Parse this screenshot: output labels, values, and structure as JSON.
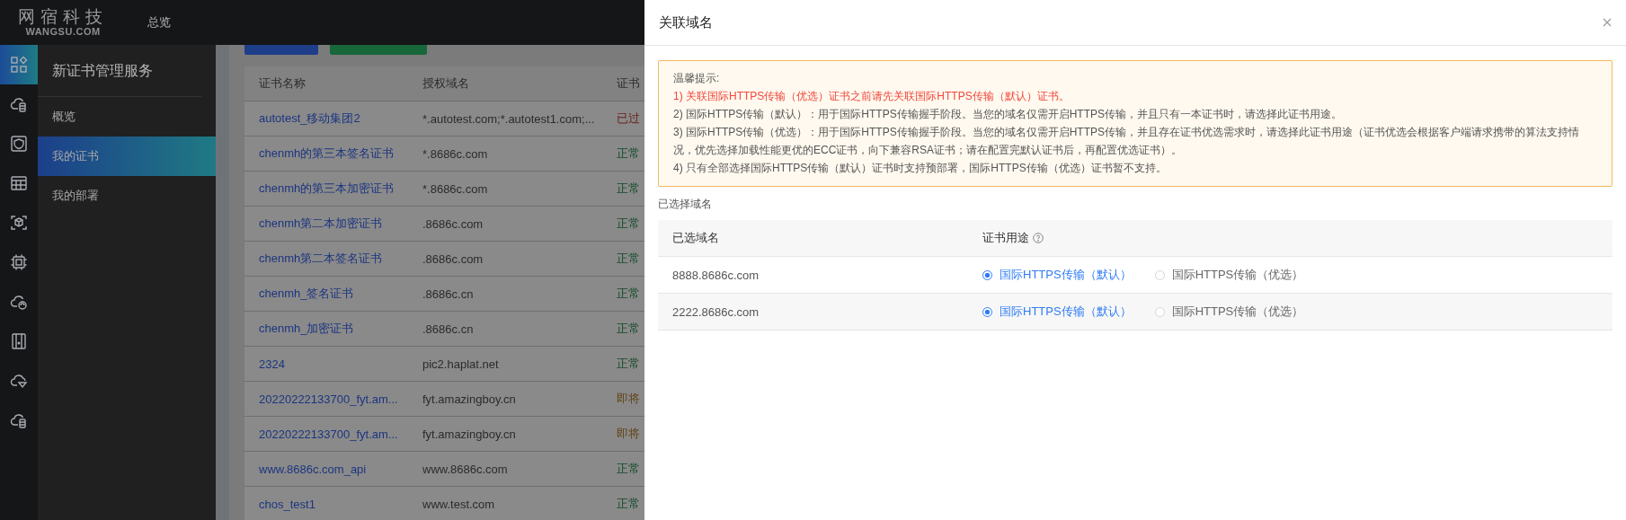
{
  "header": {
    "logo_cn": "网宿科技",
    "logo_en": "WANGSU.COM",
    "nav": "总览"
  },
  "rail": [
    {
      "selected": true
    },
    {
      "selected": false
    },
    {
      "selected": false
    },
    {
      "selected": false
    },
    {
      "selected": false
    },
    {
      "selected": false
    },
    {
      "selected": false
    },
    {
      "selected": false
    },
    {
      "selected": false
    },
    {
      "selected": false
    }
  ],
  "sidebar": {
    "title": "新证书管理服务",
    "items": [
      {
        "label": "概览",
        "selected": false
      },
      {
        "label": "我的证书",
        "selected": true
      },
      {
        "label": "我的部署",
        "selected": false
      }
    ]
  },
  "toolbar_buttons": [
    {
      "color": "#1e3e8a"
    },
    {
      "color": "#17673a"
    }
  ],
  "table": {
    "columns": [
      "证书名称",
      "授权域名",
      "证书"
    ],
    "rows": [
      {
        "name": "autotest_移动集团2",
        "domain": "*.autotest.com;*.autotest1.com;...",
        "status": "已过",
        "color": "#6a1f1a"
      },
      {
        "name": "chenmh的第三本签名证书",
        "domain": "*.8686c.com",
        "status": "正常",
        "color": "#134a29"
      },
      {
        "name": "chenmh的第三本加密证书",
        "domain": "*.8686c.com",
        "status": "正常",
        "color": "#134a29"
      },
      {
        "name": "chenmh第二本加密证书",
        "domain": ".8686c.com",
        "status": "正常",
        "color": "#134a29"
      },
      {
        "name": "chenmh第二本签名证书",
        "domain": ".8686c.com",
        "status": "正常",
        "color": "#134a29"
      },
      {
        "name": "chenmh_签名证书",
        "domain": ".8686c.cn",
        "status": "正常",
        "color": "#134a29"
      },
      {
        "name": "chenmh_加密证书",
        "domain": ".8686c.cn",
        "status": "正常",
        "color": "#134a29"
      },
      {
        "name": "2324",
        "domain": "pic2.haplat.net",
        "status": "正常",
        "color": "#134a29"
      },
      {
        "name": "20220222133700_fyt.am...",
        "domain": "fyt.amazingboy.cn",
        "status": "即将",
        "color": "#614317"
      },
      {
        "name": "20220222133700_fyt.am...",
        "domain": "fyt.amazingboy.cn",
        "status": "即将",
        "color": "#614317"
      },
      {
        "name": "www.8686c.com_api",
        "domain": "www.8686c.com",
        "status": "正常",
        "color": "#134a29"
      },
      {
        "name": "chos_test1",
        "domain": "www.test.com",
        "status": "正常",
        "color": "#134a29"
      }
    ]
  },
  "drawer": {
    "title": "关联域名",
    "notice": {
      "heading": "温馨提示:",
      "lines": [
        {
          "text": "1) 关联国际HTTPS传输（优选）证书之前请先关联国际HTTPS传输（默认）证书。",
          "kind": "warning"
        },
        {
          "text": "2) 国际HTTPS传输（默认）：用于国际HTTPS传输握手阶段。当您的域名仅需开启HTTPS传输，并且只有一本证书时，请选择此证书用途。",
          "kind": "normal"
        },
        {
          "text": "3) 国际HTTPS传输（优选）：用于国际HTTPS传输握手阶段。当您的域名仅需开启HTTPS传输，并且存在证书优选需求时，请选择此证书用途（证书优选会根据客户端请求携带的算法支持情况，优先选择加载性能更优的ECC证书，向下兼容RSA证书；请在配置完默认证书后，再配置优选证书）。",
          "kind": "normal"
        },
        {
          "text": "4) 只有全部选择国际HTTPS传输（默认）证书时支持预部署，国际HTTPS传输（优选）证书暂不支持。",
          "kind": "normal"
        }
      ]
    },
    "section_label": "已选择域名",
    "columns": [
      "已选域名",
      "证书用途"
    ],
    "rows": [
      {
        "domain": "8888.8686c.com",
        "options": [
          {
            "label": "国际HTTPS传输（默认）",
            "selected": true
          },
          {
            "label": "国际HTTPS传输（优选）",
            "selected": false
          }
        ]
      },
      {
        "domain": "2222.8686c.com",
        "options": [
          {
            "label": "国际HTTPS传输（默认）",
            "selected": true
          },
          {
            "label": "国际HTTPS传输（优选）",
            "selected": false
          }
        ]
      }
    ]
  }
}
